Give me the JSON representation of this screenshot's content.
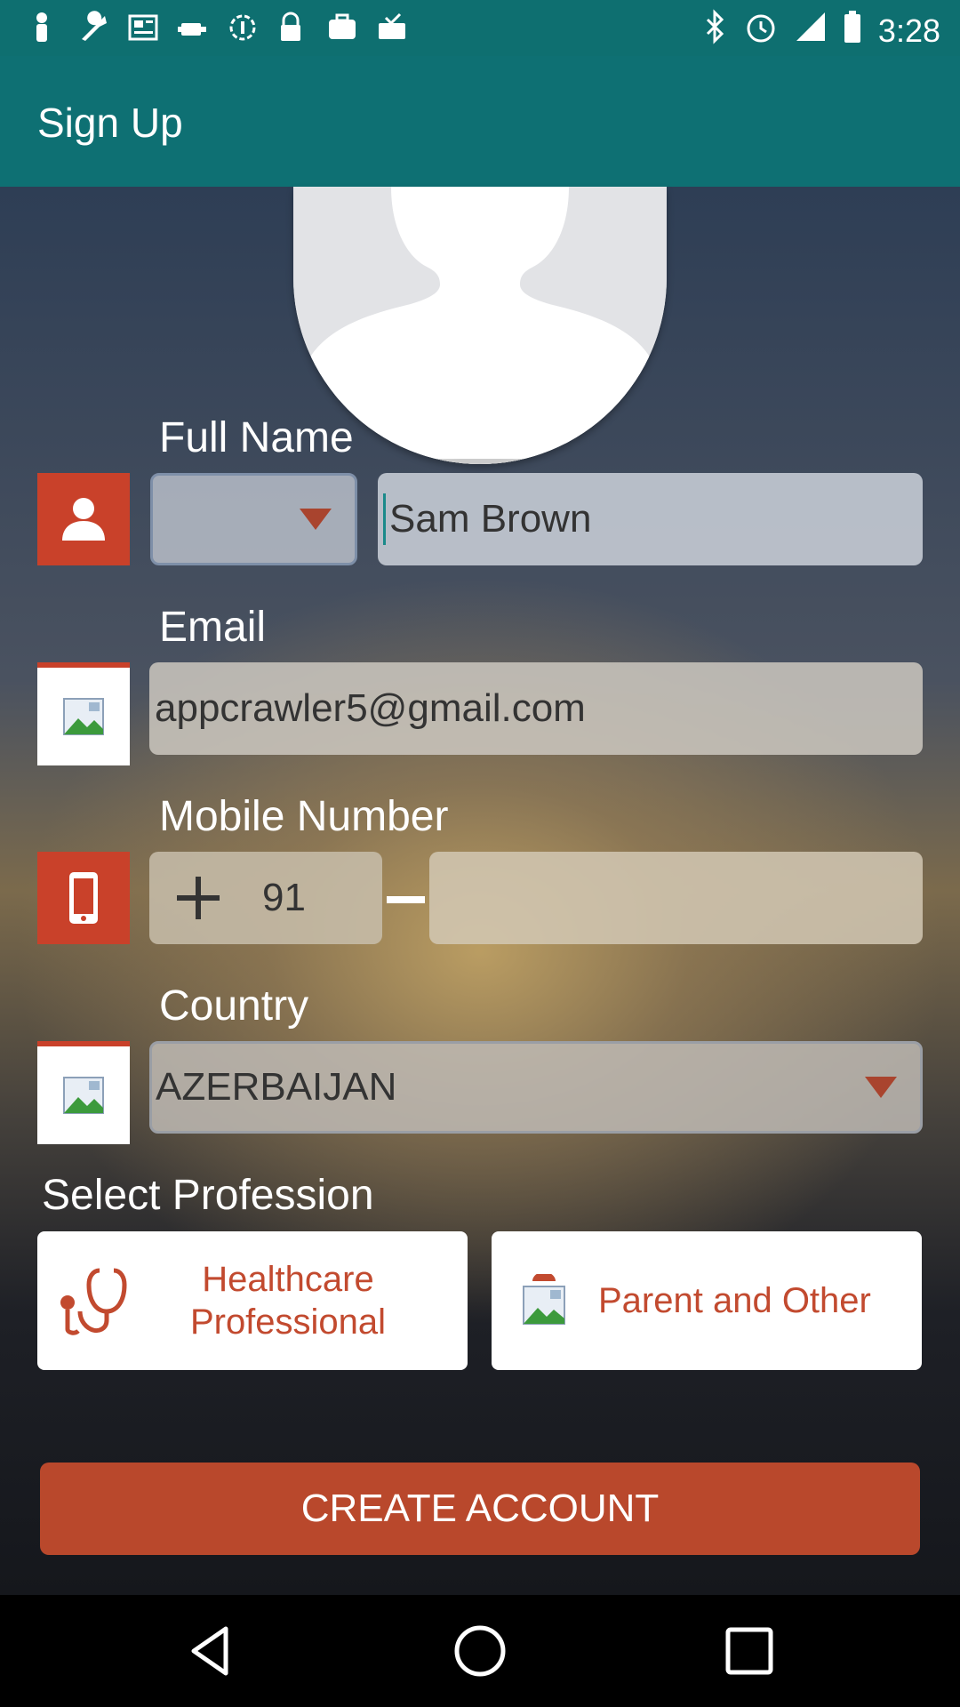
{
  "status_bar": {
    "time": "3:28",
    "left_icons": [
      "person-icon",
      "wrench-icon",
      "news-icon",
      "fake-gps-icon",
      "data-saver-icon",
      "lock-icon",
      "briefcase-icon",
      "inbox-check-icon"
    ],
    "right_icons": [
      "bluetooth-icon",
      "alarm-icon",
      "signal-icon",
      "battery-icon"
    ]
  },
  "toolbar": {
    "title": "Sign Up"
  },
  "form": {
    "full_name": {
      "label": "Full Name",
      "title_select": "",
      "value": "Sam Brown"
    },
    "email": {
      "label": "Email",
      "value": "appcrawler5@gmail.com"
    },
    "mobile": {
      "label": "Mobile Number",
      "country_code": "91",
      "separator": "–",
      "number": ""
    },
    "country": {
      "label": "Country",
      "value": "AZERBAIJAN"
    }
  },
  "profession": {
    "heading": "Select Profession",
    "options": [
      {
        "label": "Healthcare Professional",
        "icon": "stethoscope-icon"
      },
      {
        "label": "Parent and Other",
        "icon": "broken-image-icon"
      }
    ]
  },
  "actions": {
    "create_account": "CREATE ACCOUNT"
  },
  "colors": {
    "toolbar": "#0e7073",
    "accent": "#c9412a",
    "button": "#b9482c"
  }
}
